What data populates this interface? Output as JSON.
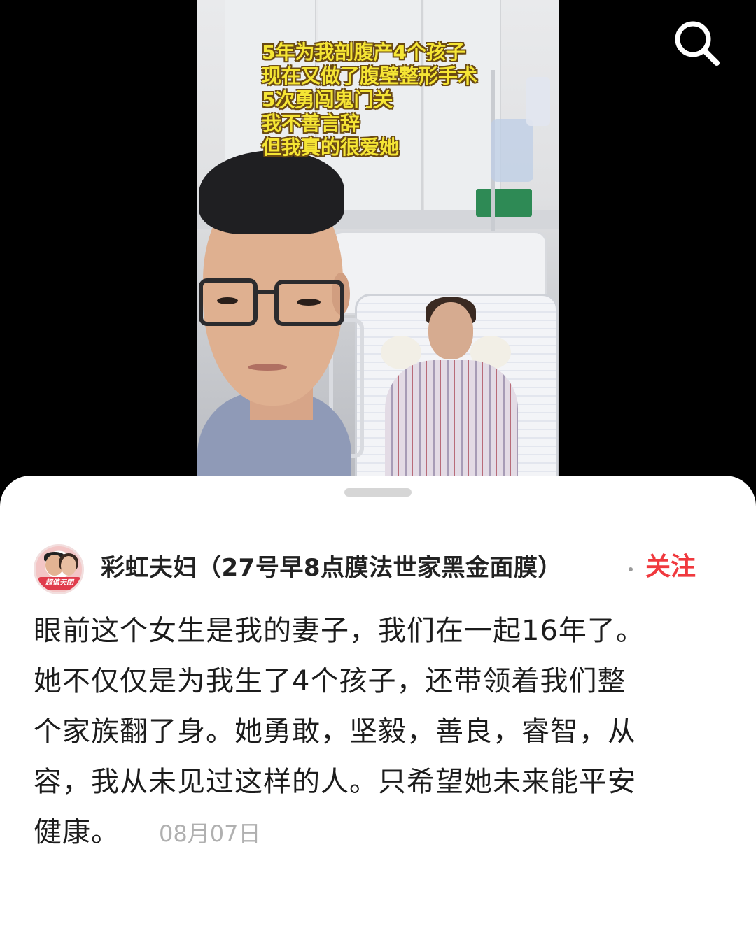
{
  "media": {
    "caption_lines": [
      "5年为我剖腹产4个孩子",
      "现在又做了腹壁整形手术",
      "5次勇闯鬼门关",
      "我不善言辞",
      "但我真的很爱她"
    ]
  },
  "toolbar": {
    "search_icon": "search-icon"
  },
  "post": {
    "author": {
      "name": "彩虹夫妇（27号早8点膜法世家黑金面膜）",
      "avatar_badge": "超值天团"
    },
    "follow_label": "关注",
    "body_lines": [
      "眼前这个女生是我的妻子，我们在一起16年了。",
      "她不仅仅是为我生了4个孩子，还带领着我们整",
      "个家族翻了身。她勇敢，坚毅，善良，睿智，从",
      "容，我从未见过这样的人。只希望她未来能平安",
      "健康。"
    ],
    "date": "08月07日"
  },
  "colors": {
    "follow": "#f0393e",
    "caption_text": "#f5e534",
    "date_text": "#b0b0b0"
  }
}
